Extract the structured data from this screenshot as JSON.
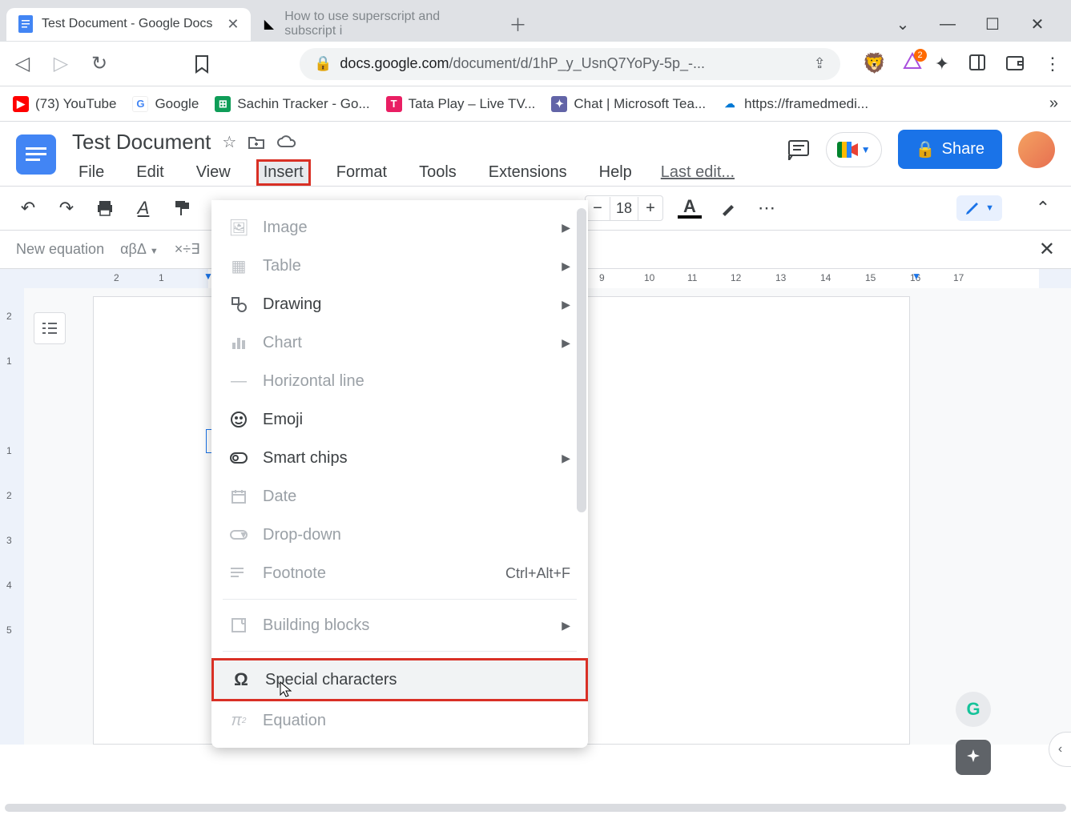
{
  "browser": {
    "tabs": [
      {
        "title": "Test Document - Google Docs",
        "active": true
      },
      {
        "title": "How to use superscript and subscript i",
        "active": false
      }
    ],
    "url_prefix": "docs.google.com",
    "url_path": "/document/d/1hP_y_UsnQ7YoPy-5p_-...",
    "brave_badge": "2"
  },
  "bookmarks": [
    {
      "label": "(73) YouTube",
      "color": "#ff0000",
      "glyph": "▶"
    },
    {
      "label": "Google",
      "color": "#ffffff",
      "glyph": "G"
    },
    {
      "label": "Sachin Tracker - Go...",
      "color": "#0f9d58",
      "glyph": "⊞"
    },
    {
      "label": "Tata Play – Live TV...",
      "color": "#e91e63",
      "glyph": "T"
    },
    {
      "label": "Chat | Microsoft Tea...",
      "color": "#6264a7",
      "glyph": "⬚"
    },
    {
      "label": "https://framedmedi...",
      "color": "#0078d4",
      "glyph": "☁"
    }
  ],
  "docs": {
    "title": "Test Document",
    "menus": [
      "File",
      "Edit",
      "View",
      "Insert",
      "Format",
      "Tools",
      "Extensions",
      "Help"
    ],
    "highlighted_menu": "Insert",
    "last_edit": "Last edit...",
    "share": "Share"
  },
  "toolbar": {
    "font_size": "18"
  },
  "equation_bar": {
    "label": "New equation",
    "greek": "αβΔ",
    "ops": "×÷∃"
  },
  "ruler": {
    "h_marks": [
      "2",
      "1",
      "1",
      "2",
      "9",
      "10",
      "11",
      "12",
      "13",
      "14",
      "15",
      "16",
      "17"
    ],
    "v_marks": [
      "2",
      "1",
      "1",
      "2",
      "3",
      "4",
      "5"
    ]
  },
  "insert_menu": [
    {
      "label": "Image",
      "icon": "🖼",
      "arrow": true,
      "disabled": true
    },
    {
      "label": "Table",
      "icon": "▦",
      "arrow": true,
      "disabled": true
    },
    {
      "label": "Drawing",
      "icon": "◫",
      "arrow": true
    },
    {
      "label": "Chart",
      "icon": "📊",
      "arrow": true,
      "disabled": true
    },
    {
      "label": "Horizontal line",
      "icon": "—",
      "disabled": true
    },
    {
      "label": "Emoji",
      "icon": "☺"
    },
    {
      "label": "Smart chips",
      "icon": "⊘",
      "arrow": true
    },
    {
      "label": "Date",
      "icon": "📅",
      "disabled": true
    },
    {
      "label": "Drop-down",
      "icon": "⬭",
      "disabled": true
    },
    {
      "label": "Footnote",
      "icon": "≡",
      "shortcut": "Ctrl+Alt+F",
      "disabled": true
    },
    {
      "sep": true
    },
    {
      "label": "Building blocks",
      "icon": "⊞",
      "arrow": true,
      "disabled": true
    },
    {
      "sep": true
    },
    {
      "label": "Special characters",
      "icon": "Ω",
      "highlighted": true
    },
    {
      "label": "Equation",
      "icon": "π²",
      "disabled": true
    }
  ]
}
